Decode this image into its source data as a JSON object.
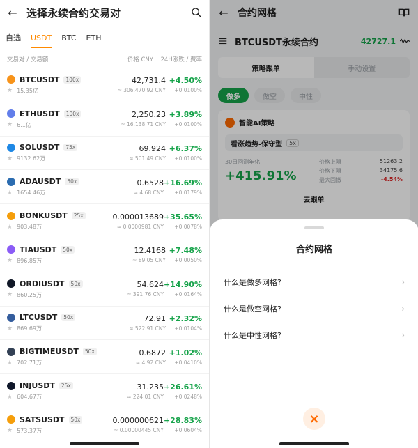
{
  "left": {
    "title": "选择永续合约交易对",
    "tabs": [
      "自选",
      "USDT",
      "BTC",
      "ETH"
    ],
    "active_tab": "USDT",
    "columns": {
      "pair": "交易对 / 交易额",
      "price": "价格 CNY",
      "change": "24H涨跌 / 费率"
    },
    "rows": [
      {
        "symbol": "BTCUSDT",
        "leverage": "100x",
        "volume": "15.35亿",
        "price": "42,731.4",
        "price_cny": "≈ 306,470.92 CNY",
        "change": "+4.50%",
        "rate": "+0.0100%",
        "color": "#f7931a"
      },
      {
        "symbol": "ETHUSDT",
        "leverage": "100x",
        "volume": "6.1亿",
        "price": "2,250.23",
        "price_cny": "≈ 16,138.71 CNY",
        "change": "+3.89%",
        "rate": "+0.0100%",
        "color": "#627eea"
      },
      {
        "symbol": "SOLUSDT",
        "leverage": "75x",
        "volume": "9132.62万",
        "price": "69.924",
        "price_cny": "≈ 501.49 CNY",
        "change": "+6.37%",
        "rate": "+0.0100%",
        "color": "#1e88e5"
      },
      {
        "symbol": "ADAUSDT",
        "leverage": "50x",
        "volume": "1654.46万",
        "price": "0.6528",
        "price_cny": "≈ 4.68 CNY",
        "change": "+16.69%",
        "rate": "+0.0179%",
        "color": "#2b6cb0"
      },
      {
        "symbol": "BONKUSDT",
        "leverage": "25x",
        "volume": "903.48万",
        "price": "0.000013689",
        "price_cny": "≈ 0.0000981 CNY",
        "change": "+35.65%",
        "rate": "+0.0078%",
        "color": "#f59e0b"
      },
      {
        "symbol": "TIAUSDT",
        "leverage": "50x",
        "volume": "896.85万",
        "price": "12.4168",
        "price_cny": "≈ 89.05 CNY",
        "change": "+7.48%",
        "rate": "+0.0050%",
        "color": "#8b5cf6"
      },
      {
        "symbol": "ORDIUSDT",
        "leverage": "50x",
        "volume": "860.25万",
        "price": "54.624",
        "price_cny": "≈ 391.76 CNY",
        "change": "+14.90%",
        "rate": "+0.0164%",
        "color": "#111827"
      },
      {
        "symbol": "LTCUSDT",
        "leverage": "50x",
        "volume": "869.69万",
        "price": "72.91",
        "price_cny": "≈ 522.91 CNY",
        "change": "+2.32%",
        "rate": "+0.0104%",
        "color": "#345d9d"
      },
      {
        "symbol": "BIGTIMEUSDT",
        "leverage": "50x",
        "volume": "702.71万",
        "price": "0.6872",
        "price_cny": "≈ 4.92 CNY",
        "change": "+1.02%",
        "rate": "+0.0410%",
        "color": "#334155"
      },
      {
        "symbol": "INJUSDT",
        "leverage": "25x",
        "volume": "604.67万",
        "price": "31.235",
        "price_cny": "≈ 224.01 CNY",
        "change": "+26.61%",
        "rate": "+0.0248%",
        "color": "#0f172a"
      },
      {
        "symbol": "SATSUSDT",
        "leverage": "50x",
        "volume": "573.37万",
        "price": "0.000000621",
        "price_cny": "≈ 0.00000445 CNY",
        "change": "+28.83%",
        "rate": "+0.0604%",
        "color": "#f59e0b"
      }
    ]
  },
  "right": {
    "title": "合约网格",
    "pair": "BTCUSDT永续合约",
    "pair_price": "42727.1",
    "segments": [
      "策略跟单",
      "手动设置"
    ],
    "active_segment": "策略跟单",
    "directions": [
      "做多",
      "做空",
      "中性"
    ],
    "active_direction": "做多",
    "ai_title": "智能AI策略",
    "strategy_name": "看涨趋势-保守型",
    "strategy_lev": "5x",
    "yield_label": "30日回测年化",
    "yield_value": "+415.91%",
    "upper_label": "价格上限",
    "upper_value": "51263.2",
    "lower_label": "价格下限",
    "lower_value": "34175.6",
    "drawdown_label": "最大回撤",
    "drawdown_value": "-4.54%",
    "follow_label": "去跟单",
    "sheet": {
      "title": "合约网格",
      "items": [
        "什么是做多网格?",
        "什么是做空网格?",
        "什么是中性网格?"
      ],
      "close_icon": "×"
    }
  }
}
